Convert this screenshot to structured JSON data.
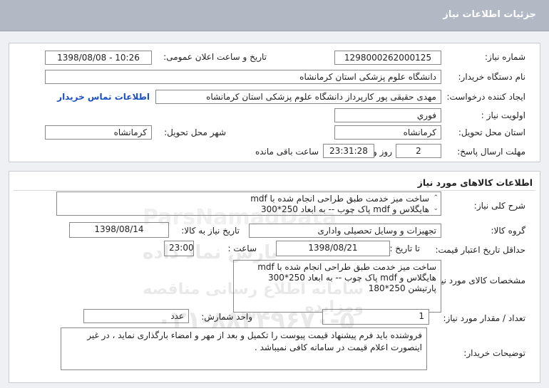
{
  "title": "جزئیات اطلاعات نیاز",
  "need_info": {
    "need_number_label": "شماره نیاز:",
    "need_number": "1298000262000125",
    "announce_label": "تاریخ و ساعت اعلان عمومی:",
    "announce_value": "1398/08/08 - 10:26",
    "buyer_org_label": "نام دستگاه خریدار:",
    "buyer_org": "دانشگاه علوم پزشکی  استان کرمانشاه",
    "creator_label": "ایجاد کننده درخواست:",
    "creator": "مهدی حقیقی پور کارپرداز دانشگاه علوم پزشکی  استان کرمانشاه",
    "contact_link": "اطلاعات تماس خریدار",
    "priority_label": "اولویت نیاز :",
    "priority": "فوري",
    "province_label": "استان محل تحویل:",
    "province": "کرمانشاه",
    "city_label": "شهر محل تحویل:",
    "city": "کرمانشاه",
    "deadline_label": "مهلت ارسال پاسخ:",
    "deadline_days": "2",
    "days_word": "روز و",
    "deadline_time": "23:31:28",
    "remaining_word": "ساعت باقی مانده"
  },
  "goods": {
    "section_title": "اطلاعات کالاهای مورد نیاز",
    "general_desc_label": "شرح کلی نیاز:",
    "general_desc_line1": "ساخت میز خدمت طبق طراحی انجام شده با mdf",
    "general_desc_line2": "هایگلاس و mdf پاک چوب  -- به ابعاد 250*300",
    "group_label": "گروه کالا:",
    "group": "تجهیزات و وسایل تحصیلی واداری",
    "need_date_label": "تاریخ نیاز به کالا:",
    "need_date": "1398/08/14",
    "price_validity_label": "حداقل تاریخ اعتبار قیمت:",
    "to_date_label": "تا تاریخ :",
    "to_date": "1398/08/21",
    "hour_label": "ساعت :",
    "hour": "23:00",
    "spec_label": "مشخصات کالای مورد نیاز:",
    "spec_line1": "ساخت میز خدمت طبق طراحی انجام شده با mdf",
    "spec_line2": "هایگلاس و mdf پاک چوب -- به ابعاد 250*300",
    "spec_line3": "پارتیشن 250*180",
    "qty_label": "تعداد / مقدار مورد نیاز:",
    "qty": "1",
    "unit_label": "واحد شمارش:",
    "unit": "عدد",
    "buyer_notes_label": "توضیحات خریدار:",
    "buyer_notes": "فروشنده باید فرم پیشنهاد قیمت پیوست را تکمیل و بعد از مهر و امضاء بارگذاری نماید ، در غیر اینصورت اعلام قیمت در سامانه کافی نمیباشد ."
  },
  "watermark": {
    "brand": "ParsNamadData",
    "tagline": "پارس نماد داده",
    "subtitle": "سامانه اطلاع رسانی مناقصه ومزایده",
    "phone": "۰۲۱-۸۸۳۴۹۶۷۰-۵"
  }
}
